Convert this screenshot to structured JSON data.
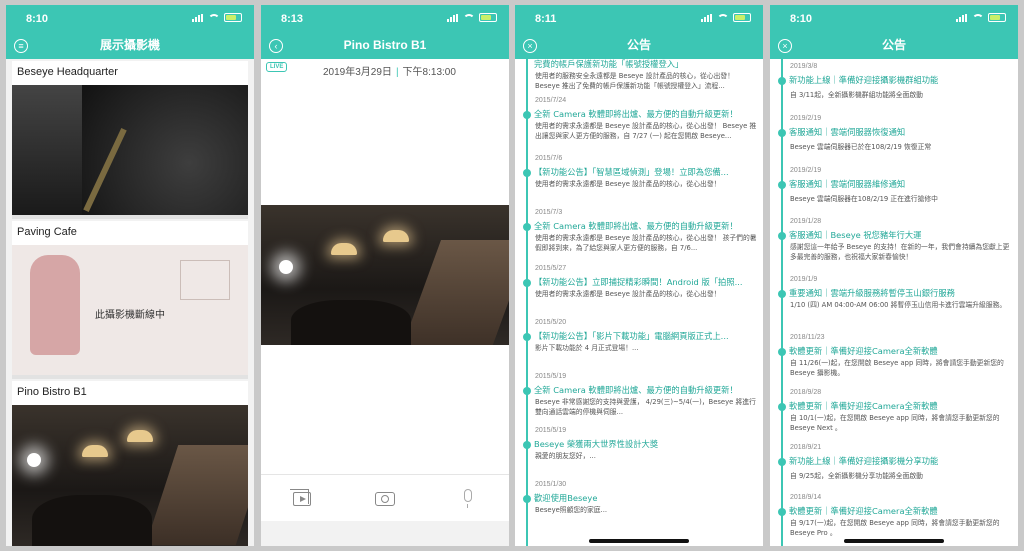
{
  "colors": {
    "accent": "#3cc6b4",
    "title_text": "#22a898",
    "frame": "#c9c9c9"
  },
  "panel1": {
    "time": "8:10",
    "title": "展示攝影機",
    "nav_icon": "menu-icon",
    "cameras": [
      {
        "name": "Beseye Headquarter"
      },
      {
        "name": "Paving Cafe",
        "status": "此攝影機斷線中"
      },
      {
        "name": "Pino Bistro B1"
      }
    ]
  },
  "panel2": {
    "time": "8:13",
    "title": "Pino Bistro B1",
    "nav_icon": "back-icon",
    "live_label": "LIVE",
    "date": "2019年3月29日",
    "sep": "|",
    "clock": "下午8:13:00",
    "toolbar": [
      "playback-icon",
      "camera-icon",
      "microphone-icon"
    ]
  },
  "panel3": {
    "time": "8:11",
    "title": "公告",
    "nav_icon": "close-icon",
    "items": [
      {
        "date": "",
        "title": "完費的帳戶保護新功能「帳號授權登入」",
        "desc": "使用者的服務安全永遠都是 Beseye 設計產品的核心，從心出發！ Beseye 推出了免費的帳戶保護新功能「帳號授權登入」流程..."
      },
      {
        "date": "2015/7/24",
        "title": "全新 Camera 軟體即將出爐、最方便的自動升級更新！",
        "desc": "使用者的需求永遠都是 Beseye 設計產品的核心，從心出發！ Beseye 推出讓您與家人更方便的服務，自 7/27 (一) 起在您開啟 Beseye..."
      },
      {
        "date": "2015/7/6",
        "title": "【新功能公告】「智慧區域偵測」登場！立即為您備...",
        "desc": "使用者的需求永遠都是 Beseye 設計產品的核心，從心出發！"
      },
      {
        "date": "2015/7/3",
        "title": "全新 Camera 軟體即將出爐、最方便的自動升級更新！",
        "desc": "使用者的需求永遠都是 Beseye 設計產品的核心，從心出發！ 孩子們的暑假即將到來，為了給您與家人更方便的服務，自 7/6..."
      },
      {
        "date": "2015/5/27",
        "title": "【新功能公告】立即捕捉精彩瞬間！Android 版「拍照...",
        "desc": "使用者的需求永遠都是 Beseye 設計產品的核心，從心出發！"
      },
      {
        "date": "2015/5/20",
        "title": "【新功能公告】「影片下載功能」電腦網頁版正式上...",
        "desc": "影片下載功能於 4 月正式登場！..."
      },
      {
        "date": "2015/5/19",
        "title": "全新 Camera 軟體即將出爐、最方便的自動升級更新！",
        "desc": "Beseye 非常感謝您的支持與愛護， 4/29(三)~5/4(一)，Beseye 將進行雙向通話雲端的停機與伺服..."
      },
      {
        "date": "2015/5/19",
        "title": "Beseye 榮獲兩大世界性設計大獎",
        "desc": "親愛的朋友您好，..."
      },
      {
        "date": "2015/1/30",
        "title": "歡迎使用Beseye",
        "desc": "Beseye照顧您的家庭..."
      }
    ]
  },
  "panel4": {
    "time": "8:10",
    "title": "公告",
    "nav_icon": "close-icon",
    "items": [
      {
        "date": "2019/3/8",
        "title": "新功能上線｜準備好迎接攝影機群組功能",
        "desc": "自 3/11起，全新攝影機群組功能將全面啟動"
      },
      {
        "date": "2019/2/19",
        "title": "客服通知｜雲端伺服器恢復通知",
        "desc": "Beseye 雲端伺服器已於在108/2/19 恢復正常"
      },
      {
        "date": "2019/2/19",
        "title": "客服通知｜雲端伺服器維修通知",
        "desc": "Beseye 雲端伺服器在108/2/19 正在進行搶修中"
      },
      {
        "date": "2019/1/28",
        "title": "客服通知｜Beseye 祝您豬年行大運",
        "desc": "感謝您這一年給予 Beseye 的支持！在新的一年，我們會持續為您獻上更多最完善的服務，也祝福大家新春愉快！"
      },
      {
        "date": "2019/1/9",
        "title": "重要通知｜雲端升級服務將暫停玉山銀行服務",
        "desc": "1/10 (四) AM 04:00-AM 06:00 將暫停玉山信用卡進行雲端升級服務。"
      },
      {
        "date": "2018/11/23",
        "title": "軟體更新｜準備好迎接Camera全新軟體",
        "desc": "自 11/26(一)起，在您開啟 Beseye app 同時，將會請您手動更新您的 Beseye 攝影機。"
      },
      {
        "date": "2018/9/28",
        "title": "軟體更新｜準備好迎接Camera全新軟體",
        "desc": "自 10/1(一)起，在您開啟 Beseye app 同時，將會請您手動更新您的 Beseye Next 。"
      },
      {
        "date": "2018/9/21",
        "title": "新功能上線｜準備好迎接攝影機分享功能",
        "desc": "自 9/25起，全新攝影機分享功能將全面啟動"
      },
      {
        "date": "2018/9/14",
        "title": "軟體更新｜準備好迎接Camera全新軟體",
        "desc": "自 9/17(一)起，在您開啟 Beseye app 同時，將會請您手動更新您的 Beseye Pro 。"
      }
    ]
  }
}
